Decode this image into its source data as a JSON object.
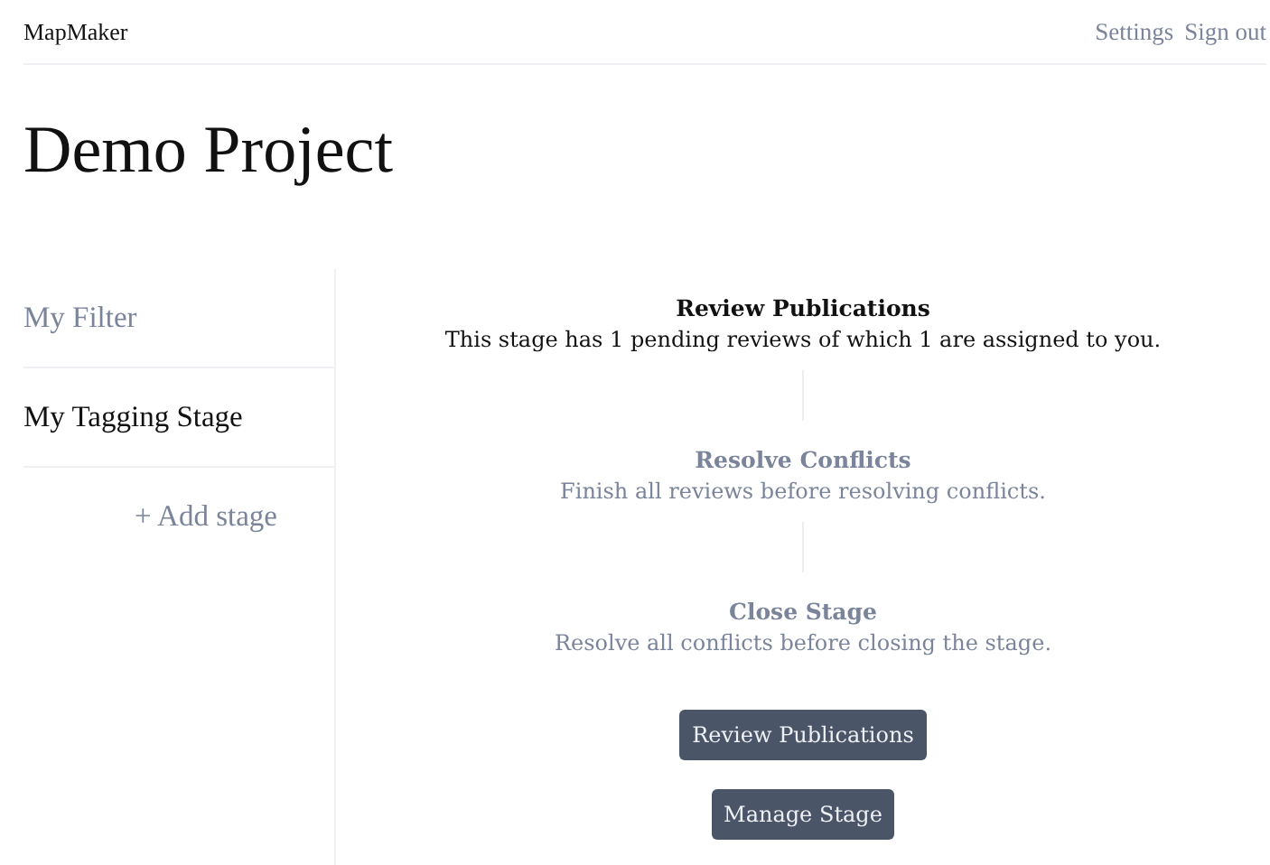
{
  "app_name": "MapMaker",
  "nav_links": [
    "Settings",
    "Sign out"
  ],
  "project_title": "Demo Project",
  "sidebar": {
    "items": [
      {
        "label": "My Filter",
        "selected": false
      },
      {
        "label": "My Tagging Stage",
        "selected": true
      }
    ],
    "add_label": "+ Add stage"
  },
  "steps": [
    {
      "title": "Review Publications",
      "description": "This stage has 1 pending reviews of which 1 are assigned to you.",
      "disabled": false
    },
    {
      "title": "Resolve Conflicts",
      "description": "Finish all reviews before resolving conflicts.",
      "disabled": true
    },
    {
      "title": "Close Stage",
      "description": "Resolve all conflicts before closing the stage.",
      "disabled": true
    }
  ],
  "buttons": [
    "Review Publications",
    "Manage Stage"
  ]
}
